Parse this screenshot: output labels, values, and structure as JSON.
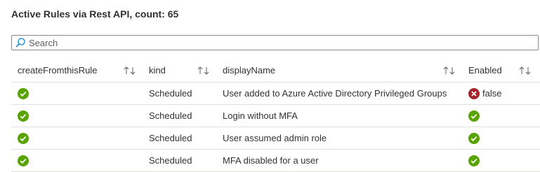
{
  "page": {
    "title": "Active Rules via Rest API, count: 65"
  },
  "search": {
    "placeholder": "Search",
    "value": ""
  },
  "table": {
    "columns": [
      {
        "label": "createFromthisRule"
      },
      {
        "label": "kind"
      },
      {
        "label": "displayName"
      },
      {
        "label": "Enabled"
      }
    ],
    "rows": [
      {
        "createFromthisRule": "check",
        "kind": "Scheduled",
        "displayName": "User added to Azure Active Directory Privileged Groups",
        "enabled": "false",
        "enabled_icon": "error-circle-icon"
      },
      {
        "createFromthisRule": "check",
        "kind": "Scheduled",
        "displayName": "Login without MFA",
        "enabled": "true",
        "enabled_icon": "check-circle-icon"
      },
      {
        "createFromthisRule": "check",
        "kind": "Scheduled",
        "displayName": "User assumed admin role",
        "enabled": "true",
        "enabled_icon": "check-circle-icon"
      },
      {
        "createFromthisRule": "check",
        "kind": "Scheduled",
        "displayName": "MFA disabled for a user",
        "enabled": "true",
        "enabled_icon": "check-circle-icon"
      }
    ]
  },
  "colors": {
    "success": "#57a300",
    "error": "#a4262c",
    "border": "#e1dfdd",
    "text": "#323130"
  }
}
